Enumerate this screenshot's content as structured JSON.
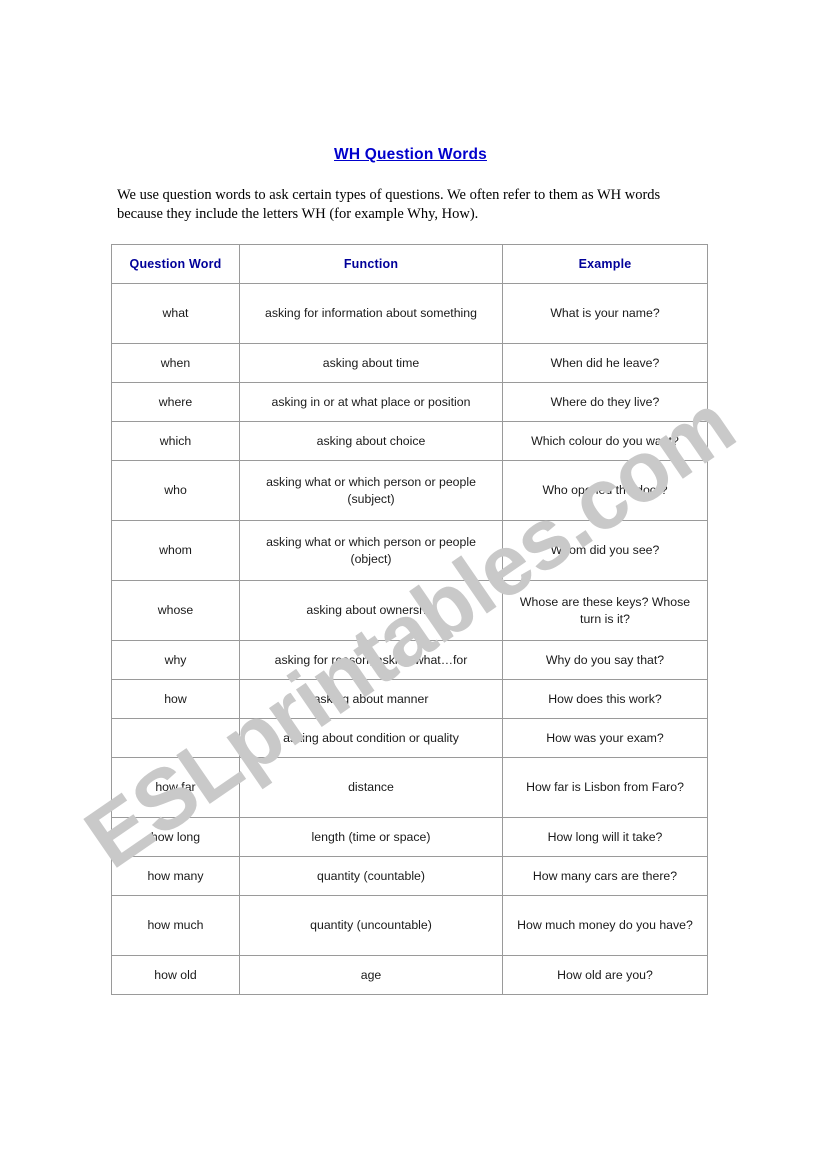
{
  "document": {
    "title": "WH Question Words",
    "intro": "We use question words to ask certain types of questions. We often refer to them as WH words because they include the letters WH (for example Why, How)."
  },
  "watermark": {
    "text": "ESLprintables.com",
    "color": "#c9c9c9"
  },
  "colors": {
    "title_blue": "#0000CC",
    "header_blue": "#000099",
    "border_gray": "#9A9A9A",
    "body_text": "#1A1A1A",
    "page_background": "#FFFFFF"
  },
  "table": {
    "headers": [
      "Question Word",
      "Function",
      "Example"
    ],
    "rows": [
      {
        "word": "what",
        "function": "asking for information about something",
        "example": "What is your name?",
        "lines": 2
      },
      {
        "word": "when",
        "function": "asking about time",
        "example": "When did he leave?",
        "lines": 1
      },
      {
        "word": "where",
        "function": "asking in or at what place or position",
        "example": "Where do they live?",
        "lines": 1
      },
      {
        "word": "which",
        "function": "asking about choice",
        "example": "Which colour do you want?",
        "lines": 1
      },
      {
        "word": "who",
        "function": "asking what or which person or people (subject)",
        "example": "Who opened the door?",
        "lines": 2
      },
      {
        "word": "whom",
        "function": "asking what or which person or people (object)",
        "example": "Whom did you see?",
        "lines": 2
      },
      {
        "word": "whose",
        "function": "asking about ownership",
        "example": "Whose are these keys? Whose turn is it?",
        "lines": 2
      },
      {
        "word": "why",
        "function": "asking for reason, asking what…for",
        "example": "Why do you say that?",
        "lines": 1
      },
      {
        "word": "how",
        "function": "asking about manner",
        "example": "How does this work?",
        "lines": 1
      },
      {
        "word": "",
        "function": "asking about condition or quality",
        "example": "How was your exam?",
        "lines": 1
      },
      {
        "word": "how far",
        "function": "distance",
        "example": "How far is Lisbon from Faro?",
        "lines": 2
      },
      {
        "word": "how long",
        "function": "length (time or space)",
        "example": "How long will it take?",
        "lines": 1
      },
      {
        "word": "how many",
        "function": "quantity (countable)",
        "example": "How many cars are there?",
        "lines": 1
      },
      {
        "word": "how much",
        "function": "quantity (uncountable)",
        "example": "How much money do you have?",
        "lines": 2
      },
      {
        "word": "how old",
        "function": "age",
        "example": "How old are you?",
        "lines": 1
      }
    ]
  }
}
